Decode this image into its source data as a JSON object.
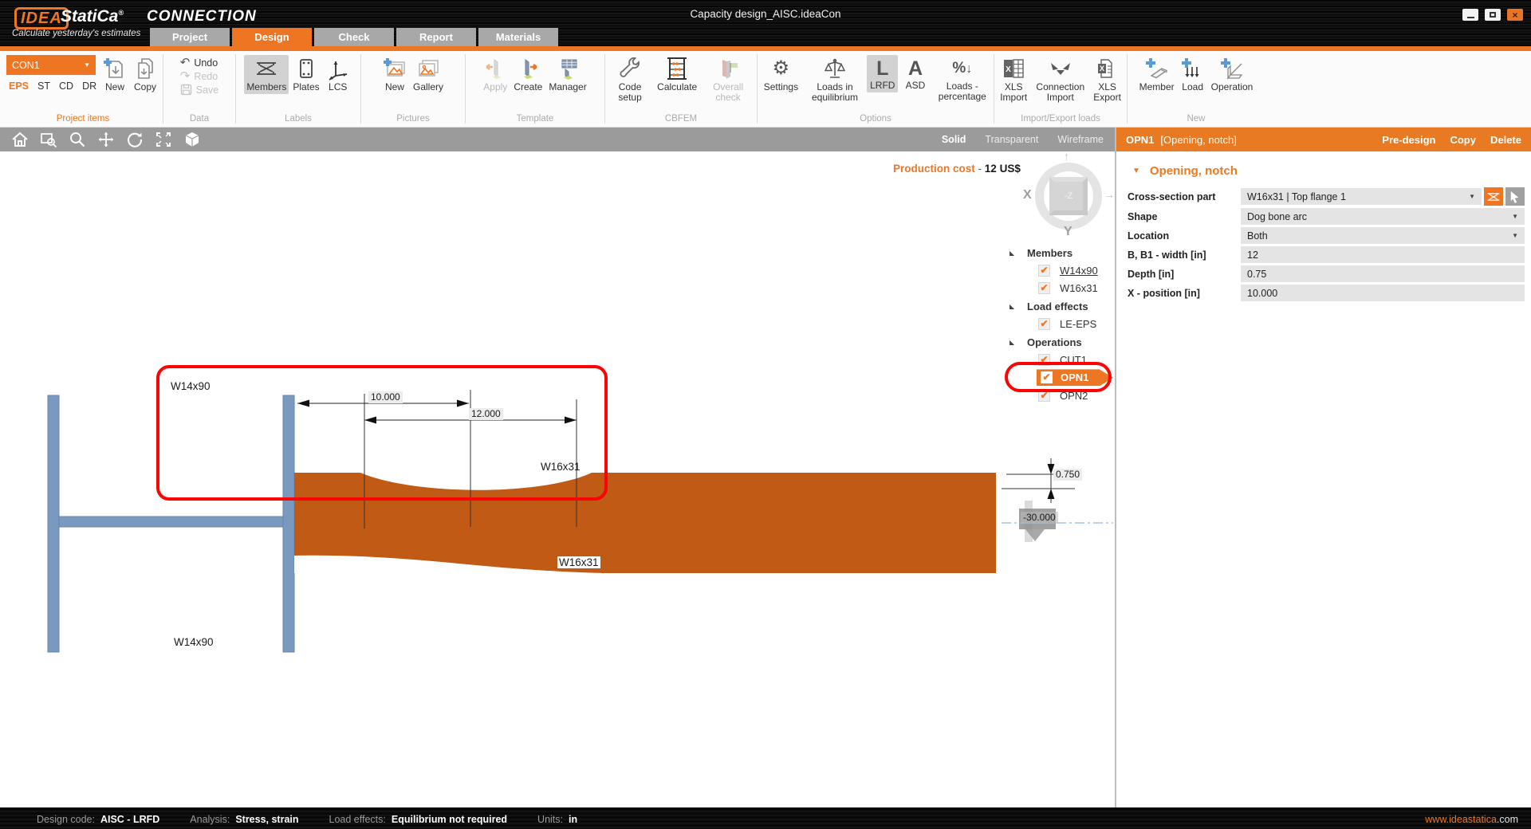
{
  "titlebar": {
    "logo_idea": "IDEA",
    "logo_statica": "StatiCa",
    "logo_reg": "®",
    "product": "CONNECTION",
    "tagline": "Calculate yesterday's estimates",
    "document_title": "Capacity design_AISC.ideaCon",
    "tabs": [
      {
        "label": "Project",
        "active": false
      },
      {
        "label": "Design",
        "active": true
      },
      {
        "label": "Check",
        "active": false
      },
      {
        "label": "Report",
        "active": false
      },
      {
        "label": "Materials",
        "active": false
      }
    ]
  },
  "ribbon": {
    "project_items": {
      "group_label": "Project items",
      "selector": "CON1",
      "modes": [
        "EPS",
        "ST",
        "CD",
        "DR"
      ],
      "active_mode": "EPS",
      "new_label": "New",
      "copy_label": "Copy"
    },
    "data_group": {
      "group_label": "Data",
      "undo": "Undo",
      "redo": "Redo",
      "save": "Save"
    },
    "labels_group": {
      "group_label": "Labels",
      "members": "Members",
      "plates": "Plates",
      "lcs": "LCS",
      "active": "Members"
    },
    "pictures_group": {
      "group_label": "Pictures",
      "new": "New",
      "gallery": "Gallery"
    },
    "template_group": {
      "group_label": "Template",
      "apply": "Apply",
      "create": "Create",
      "manager": "Manager"
    },
    "cbfem_group": {
      "group_label": "CBFEM",
      "code_setup": "Code setup",
      "calculate": "Calculate",
      "overall_check": "Overall check"
    },
    "options_group": {
      "group_label": "Options",
      "settings": "Settings",
      "loads_eq": "Loads in equilibrium",
      "lrfd": "LRFD",
      "asd": "ASD",
      "loads_pct": "Loads - percentage",
      "lrfd_letter": "L",
      "asd_letter": "A",
      "active": "LRFD"
    },
    "import_export_group": {
      "group_label": "Import/Export loads",
      "xls_import": "XLS Import",
      "conn_import": "Connection Import",
      "xls_export": "XLS Export"
    },
    "new_group": {
      "group_label": "New",
      "member": "Member",
      "load": "Load",
      "operation": "Operation"
    }
  },
  "viewbar": {
    "view_modes": [
      "Solid",
      "Transparent",
      "Wireframe"
    ],
    "active_view": "Solid"
  },
  "canvas": {
    "production_cost_label": "Production cost",
    "production_cost_sep": "-",
    "production_cost_value": "12 US$",
    "axis": {
      "x": "X",
      "y": "Y",
      "z": "-Z"
    },
    "labels": {
      "member_top": "W14x90",
      "member_bottom": "W14x90",
      "beam_top": "W16x31",
      "beam_mid": "W16x31"
    },
    "dimensions": {
      "dim1": "10.000",
      "dim2": "12.000",
      "dim3": "0.750",
      "dim4": "-30.000"
    }
  },
  "tree": {
    "sections": [
      {
        "label": "Members",
        "items": [
          {
            "label": "W14x90",
            "checked": true
          },
          {
            "label": "W16x31",
            "checked": true
          }
        ]
      },
      {
        "label": "Load effects",
        "items": [
          {
            "label": "LE-EPS",
            "checked": true
          }
        ]
      },
      {
        "label": "Operations",
        "items": [
          {
            "label": "CUT1",
            "checked": true
          },
          {
            "label": "OPN1",
            "checked": true,
            "selected": true
          },
          {
            "label": "OPN2",
            "checked": true
          }
        ]
      }
    ]
  },
  "properties": {
    "header_code": "OPN1",
    "header_type": "[Opening, notch]",
    "header_actions": [
      "Pre-design",
      "Copy",
      "Delete"
    ],
    "section_title": "Opening, notch",
    "rows": [
      {
        "label": "Cross-section part",
        "value": "W16x31 | Top flange 1"
      },
      {
        "label": "Shape",
        "value": "Dog bone arc"
      },
      {
        "label": "Location",
        "value": "Both"
      },
      {
        "label": "B, B1 - width [in]",
        "value": "12"
      },
      {
        "label": "Depth [in]",
        "value": "0.75"
      },
      {
        "label": "X - position [in]",
        "value": "10.000"
      }
    ]
  },
  "statusbar": {
    "items": [
      {
        "label": "Design code:",
        "value": "AISC - LRFD"
      },
      {
        "label": "Analysis:",
        "value": "Stress, strain"
      },
      {
        "label": "Load effects:",
        "value": "Equilibrium not required"
      },
      {
        "label": "Units:",
        "value": "in"
      }
    ],
    "website_main": "www.ideastatica",
    "website_tld": ".com"
  },
  "colors": {
    "accent": "#ee7623",
    "beam": "#c05a15",
    "steel": "#7a99bf",
    "toolbar": "#9b9b9b",
    "annotation": "#fb0404"
  }
}
